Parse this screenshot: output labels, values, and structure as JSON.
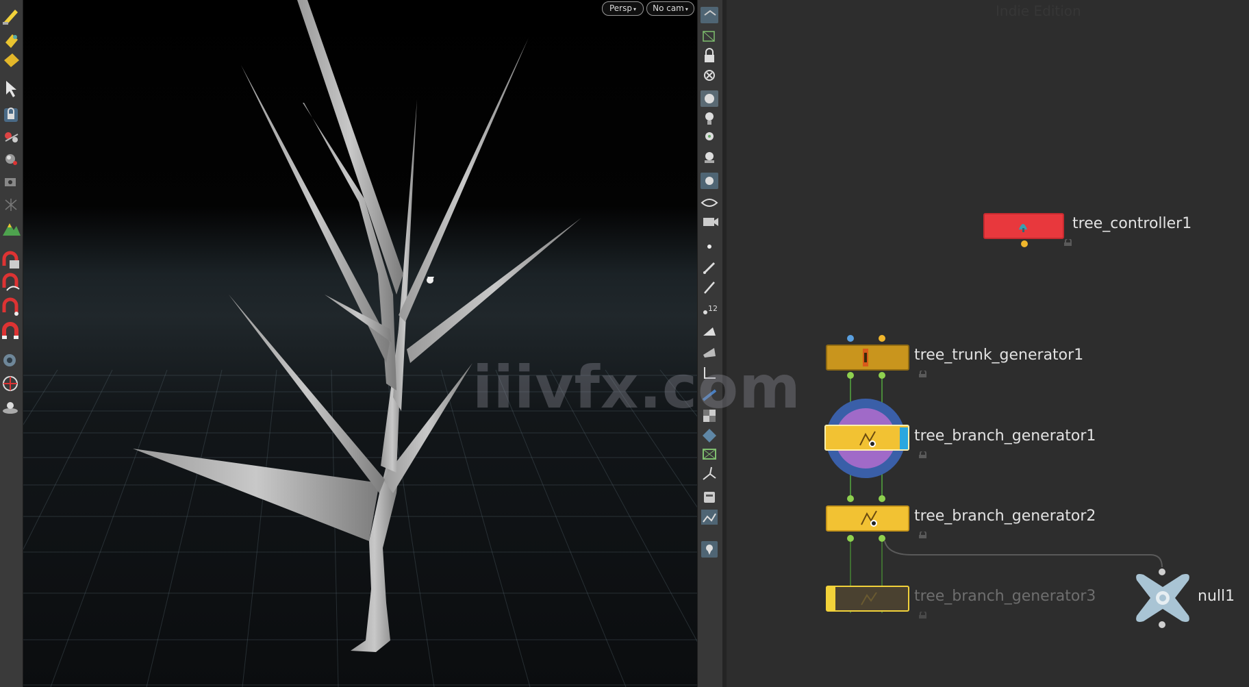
{
  "viewport": {
    "persp_label": "Persp",
    "cam_label": "No cam"
  },
  "network": {
    "edition_label": "Indie Edition",
    "nodes": [
      {
        "id": "tree_controller1",
        "label": "tree_controller1",
        "color": "#e8383d",
        "state": "active"
      },
      {
        "id": "tree_trunk_generator1",
        "label": "tree_trunk_generator1",
        "color": "#c9951d",
        "state": "active"
      },
      {
        "id": "tree_branch_generator1",
        "label": "tree_branch_generator1",
        "color": "#f2c233",
        "state": "display"
      },
      {
        "id": "tree_branch_generator2",
        "label": "tree_branch_generator2",
        "color": "#f2c233",
        "state": "active"
      },
      {
        "id": "tree_branch_generator3",
        "label": "tree_branch_generator3",
        "color": "#4a4130",
        "state": "bypassed"
      },
      {
        "id": "null1",
        "label": "null1",
        "color": "#a9c4d4",
        "state": "active"
      }
    ]
  },
  "watermark": "iiivfx.com",
  "icons": {
    "left_shelf": [
      "paint-icon",
      "uv-icon",
      "shape-icon",
      "select-arrow-icon",
      "lock-icon",
      "handle-icon",
      "sphere-icon",
      "camera-icon",
      "grid-icon",
      "terrain-icon",
      "magnet-snap-icon",
      "magnet-curve-icon",
      "magnet-point-icon",
      "magnet-icon",
      "render-icon",
      "target-icon",
      "light-icon"
    ],
    "viewport_toolbar": [
      "display-options-icon",
      "wireframe-icon",
      "lock-icon",
      "pin-icon",
      "ghost-icon",
      "light-icon",
      "light-bulb-icon",
      "spotlight-icon",
      "snapshot-icon",
      "eye-icon",
      "camera-icon",
      "point-icon",
      "brush-icon",
      "pen-icon",
      "number-12-icon",
      "shade-icon",
      "texture-icon",
      "normals-icon",
      "bone-icon",
      "checker-icon",
      "diamond-icon",
      "grid-icon",
      "vector-icon",
      "box-icon",
      "image-icon",
      "pin-marker-icon"
    ]
  }
}
